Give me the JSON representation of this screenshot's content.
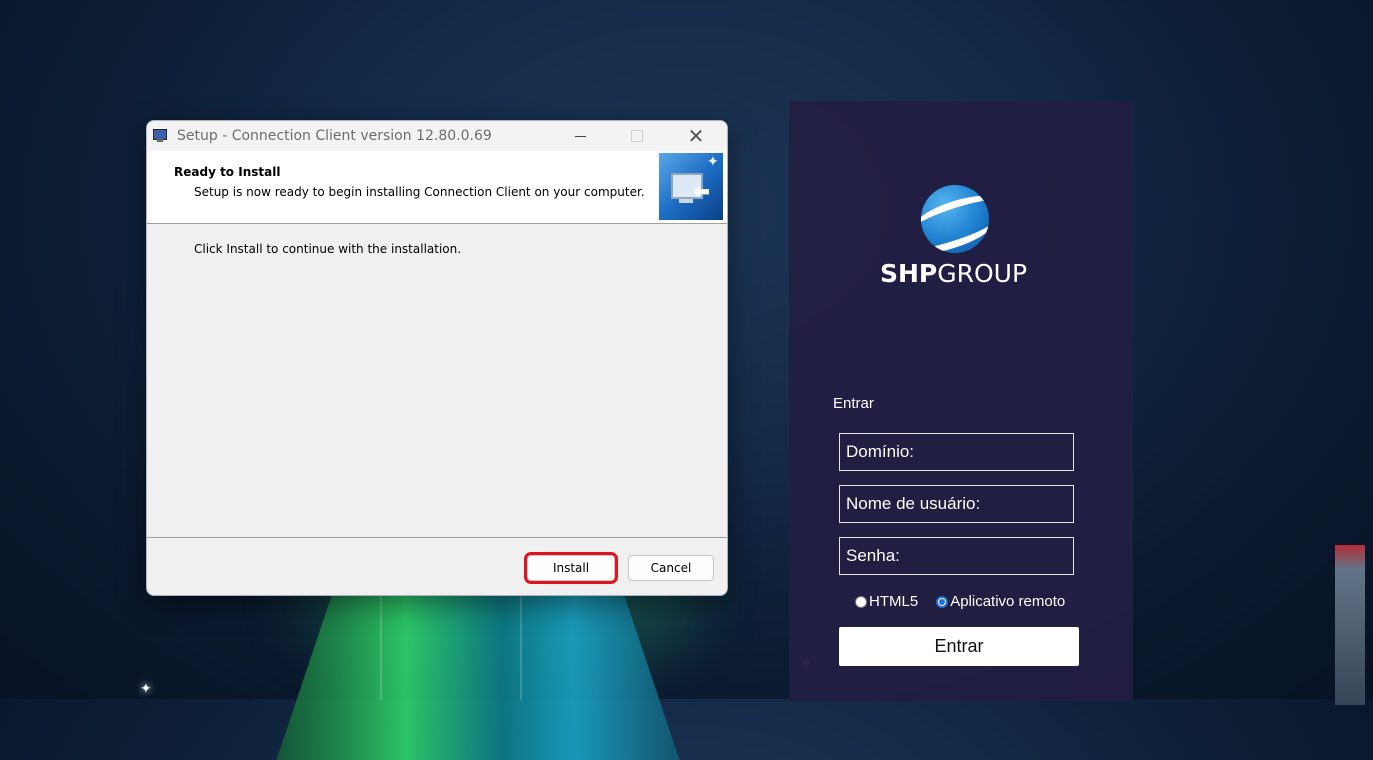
{
  "setup_window": {
    "title": "Setup - Connection Client version 12.80.0.69",
    "header_title": "Ready to Install",
    "header_subtitle": "Setup is now ready to begin installing Connection Client on your computer.",
    "body_text": "Click Install to continue with the installation.",
    "install_label": "Install",
    "cancel_label": "Cancel",
    "close_glyph": "✕",
    "highlight_color": "#e0141e"
  },
  "login_panel": {
    "logo_text_bold": "SHP",
    "logo_text_light": "GROUP",
    "heading": "Entrar",
    "fields": {
      "domain_placeholder": "Domínio:",
      "username_placeholder": "Nome de usuário:",
      "password_placeholder": "Senha:"
    },
    "radio_html5": "HTML5",
    "radio_remote": "Aplicativo remoto",
    "selected_mode": "Aplicativo remoto",
    "submit_label": "Entrar",
    "panel_color": "#211e42"
  }
}
